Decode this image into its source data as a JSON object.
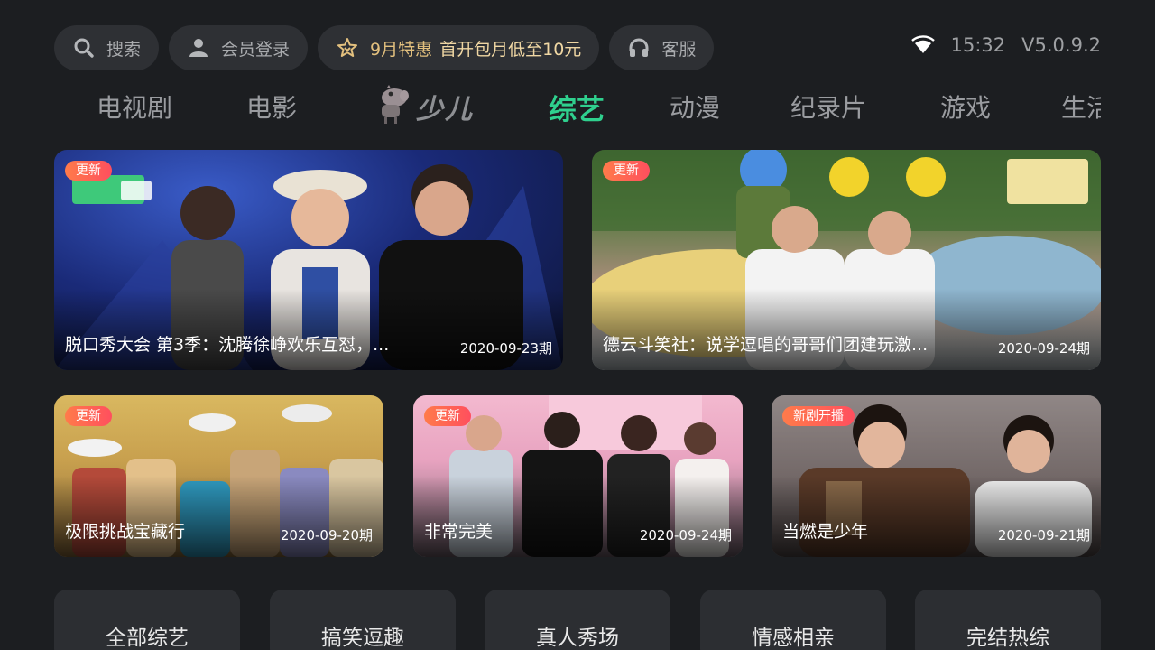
{
  "topbar": {
    "search_label": "搜索",
    "login_label": "会员登录",
    "promo_month": "9月特惠",
    "promo_offer": "首开包月低至10元",
    "service_label": "客服"
  },
  "status": {
    "time": "15:32",
    "version": "V5.0.9.2"
  },
  "tabs": {
    "tv": "电视剧",
    "movie": "电影",
    "kids": "少儿",
    "variety": "综艺",
    "anime": "动漫",
    "documentary": "纪录片",
    "game": "游戏",
    "life": "生活"
  },
  "cards": [
    {
      "badge": "更新",
      "title": "脱口秀大会 第3季：沈腾徐峥欢乐互怼，...",
      "date": "2020-09-23期"
    },
    {
      "badge": "更新",
      "title": "德云斗笑社：说学逗唱的哥哥们团建玩激...",
      "date": "2020-09-24期"
    },
    {
      "badge": "更新",
      "title": "极限挑战宝藏行",
      "date": "2020-09-20期"
    },
    {
      "badge": "更新",
      "title": "非常完美",
      "date": "2020-09-24期"
    },
    {
      "badge": "新剧开播",
      "title": "当燃是少年",
      "date": "2020-09-21期"
    }
  ],
  "chips": [
    "全部综艺",
    "搞笑逗趣",
    "真人秀场",
    "情感相亲",
    "完结热综"
  ],
  "colors": {
    "background": "#1c1e21",
    "active_tab": "#2fd08e",
    "badge_start": "#ff7b4a",
    "badge_end": "#ff4f5e",
    "promo_text": "#e3c07e"
  },
  "icons": {
    "search": "search-icon",
    "login": "user-icon",
    "promo": "star-crown-icon",
    "service": "headset-icon",
    "wifi": "wifi-icon",
    "kids": "peppa-pig-icon"
  }
}
